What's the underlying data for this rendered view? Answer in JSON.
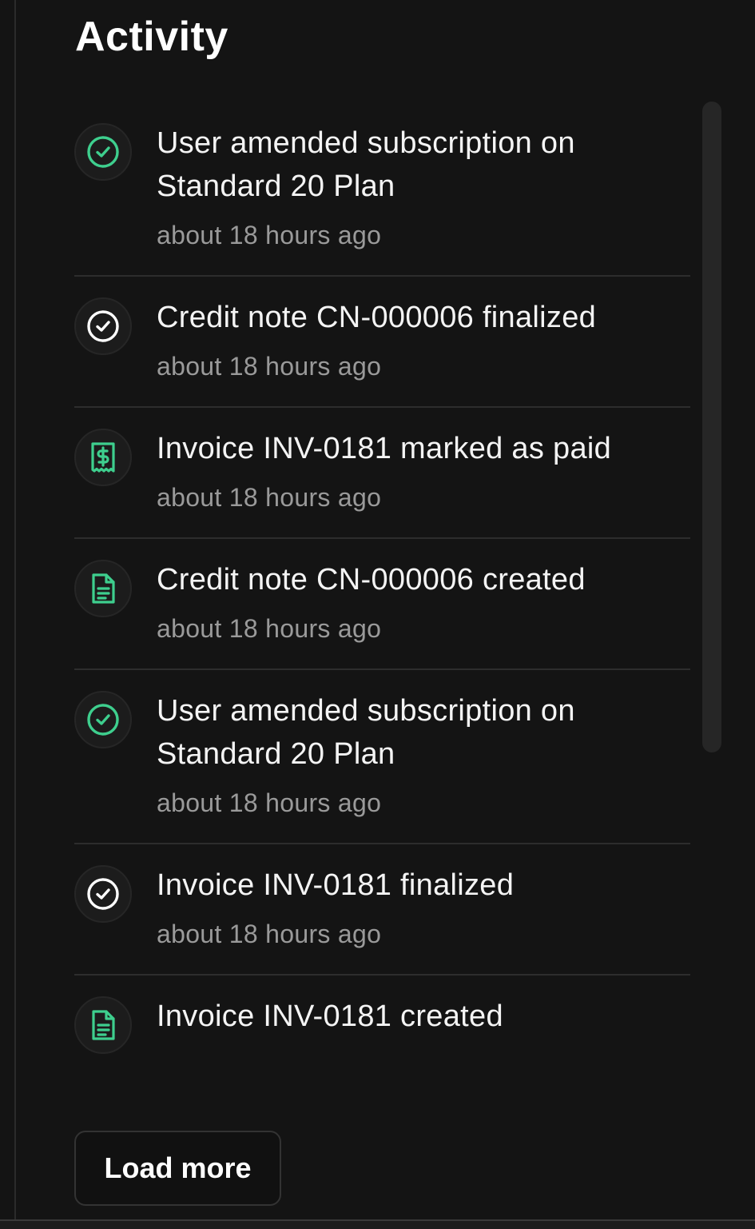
{
  "activity": {
    "title": "Activity",
    "items": [
      {
        "icon": "circle-check-icon",
        "icon_color": "#3ecf8e",
        "title": "User amended subscription on Standard 20 Plan",
        "time": "about 18 hours ago"
      },
      {
        "icon": "circle-check-icon",
        "icon_color": "#ffffff",
        "title": "Credit note CN-000006 finalized",
        "time": "about 18 hours ago"
      },
      {
        "icon": "receipt-dollar-icon",
        "icon_color": "#3ecf8e",
        "title": "Invoice INV-0181 marked as paid",
        "time": "about 18 hours ago"
      },
      {
        "icon": "document-icon",
        "icon_color": "#3ecf8e",
        "title": "Credit note CN-000006 created",
        "time": "about 18 hours ago"
      },
      {
        "icon": "circle-check-icon",
        "icon_color": "#3ecf8e",
        "title": "User amended subscription on Standard 20 Plan",
        "time": "about 18 hours ago"
      },
      {
        "icon": "circle-check-icon",
        "icon_color": "#ffffff",
        "title": "Invoice INV-0181 finalized",
        "time": "about 18 hours ago"
      },
      {
        "icon": "document-icon",
        "icon_color": "#3ecf8e",
        "title": "Invoice INV-0181 created",
        "time": ""
      }
    ],
    "load_more_label": "Load more"
  },
  "colors": {
    "background": "#141414",
    "accent": "#3ecf8e",
    "text_primary": "#f4f4f4",
    "text_secondary": "#9a9a9a"
  }
}
